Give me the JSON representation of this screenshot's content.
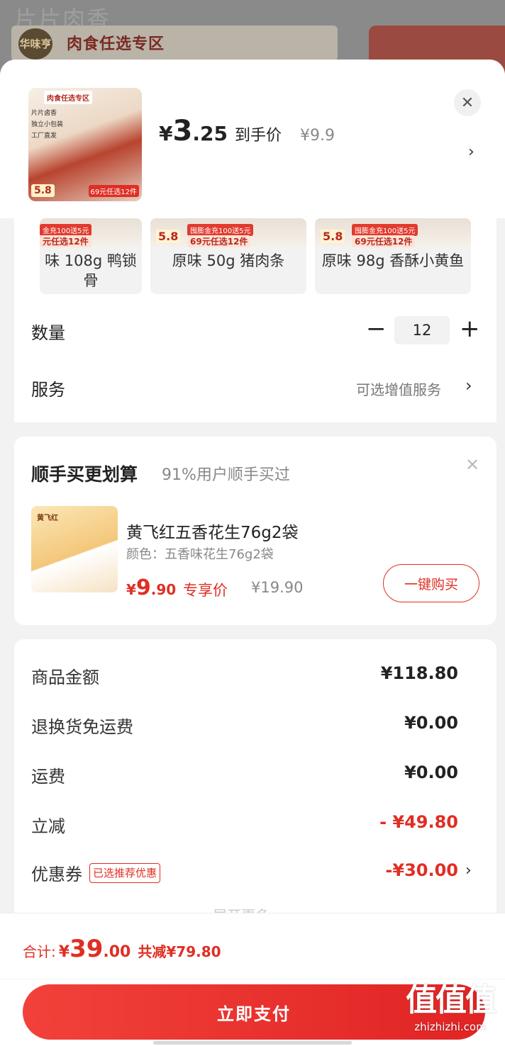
{
  "backdrop": {
    "title": "片片肉香",
    "logo_text": "华味亨",
    "banner": "肉食任选专区"
  },
  "product": {
    "thumb_tag": "肉食任选专区",
    "thumb_lines": [
      "片片卤香",
      "独立小包装",
      "工厂直发"
    ],
    "thumb_price": "5.8",
    "thumb_strip": "69元任选12件",
    "currency": "¥",
    "price_int": "3",
    "price_dec": ".25",
    "price_label": "到手价",
    "orig_price": "¥9.9"
  },
  "variants": [
    {
      "badge": "5.8",
      "strip_top": "金充100送5元",
      "strip": "元任选12件",
      "name": "味 108g 鸭锁骨"
    },
    {
      "badge": "5.8",
      "strip_top": "囤膨金充100送5元",
      "strip": "69元任选12件",
      "name": "原味 50g 猪肉条"
    },
    {
      "badge": "5.8",
      "strip_top": "囤膨金充100送5元",
      "strip": "69元任选12件",
      "name": "原味 98g 香酥小黄鱼"
    }
  ],
  "quantity": {
    "label": "数量",
    "minus": "−",
    "value": "12",
    "plus": "+"
  },
  "service": {
    "label": "服务",
    "value": "可选增值服务",
    "chevron": "›"
  },
  "bundle": {
    "title": "顺手买更划算",
    "subtitle": "91%用户顺手买过",
    "img_tag": "黄飞红",
    "name": "黄飞红五香花生76g2袋",
    "spec": "颜色：五香味花生76g2袋",
    "currency": "¥",
    "price_int": "9",
    "price_dec": ".90",
    "price_label": "专享价",
    "orig_price": "¥19.90",
    "button": "一键购买"
  },
  "summary": {
    "rows": [
      {
        "label": "商品金额",
        "value": "¥118.80"
      },
      {
        "label": "退换货免运费",
        "value": "¥0.00"
      },
      {
        "label": "运费",
        "value": "¥0.00"
      },
      {
        "label": "立减",
        "value": "- ¥49.80"
      },
      {
        "label": "优惠券",
        "tag": "已选推荐优惠",
        "value": "-¥30.00"
      }
    ],
    "more": "展开更多"
  },
  "footer": {
    "total_label": "合计:",
    "currency": "¥",
    "total_int": "39",
    "total_dec": ".00",
    "saved": "共减¥79.80",
    "pay_button": "立即支付"
  },
  "watermark": {
    "big": "值值值",
    "small": "zhizhizhi.com"
  },
  "colors": {
    "accent": "#e02e24",
    "text": "#222222",
    "muted": "#888888"
  }
}
